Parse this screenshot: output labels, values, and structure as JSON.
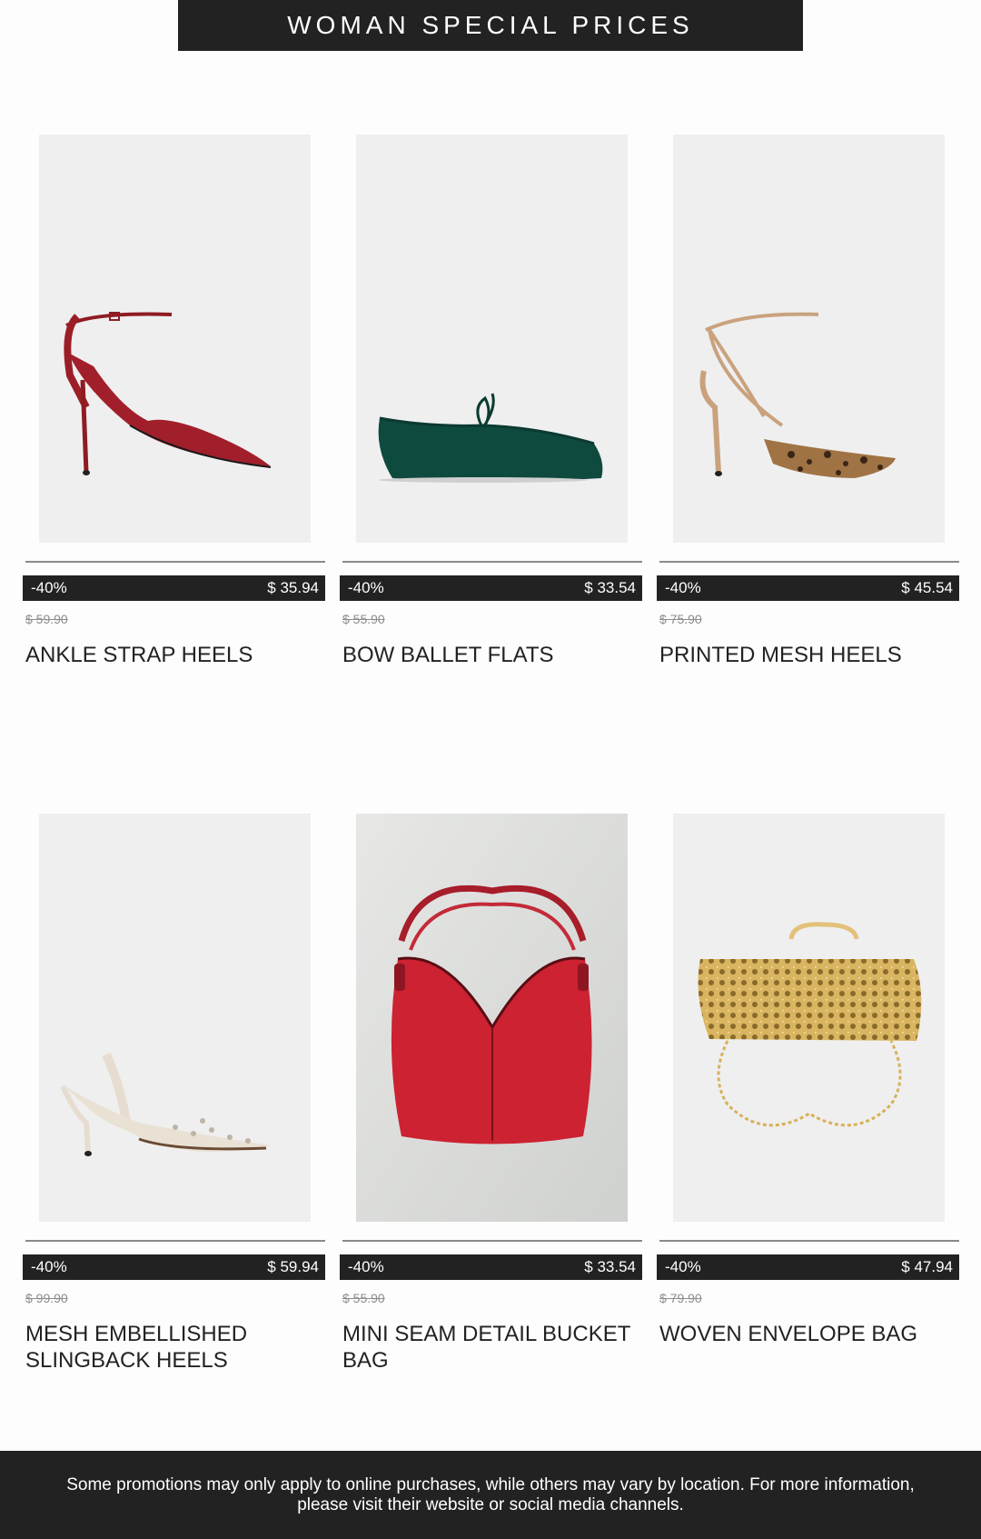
{
  "banner": {
    "title": "WOMAN SPECIAL PRICES"
  },
  "products": [
    {
      "discount": "-40%",
      "price": "$ 35.94",
      "old_price": "$ 59.90",
      "name": "ANKLE STRAP HEELS",
      "image": "red-ankle-strap-heel"
    },
    {
      "discount": "-40%",
      "price": "$ 33.54",
      "old_price": "$ 55.90",
      "name": "BOW BALLET FLATS",
      "image": "green-ballet-flat"
    },
    {
      "discount": "-40%",
      "price": "$ 45.54",
      "old_price": "$ 75.90",
      "name": "PRINTED MESH HEELS",
      "image": "leopard-mesh-heel"
    },
    {
      "discount": "-40%",
      "price": "$ 59.94",
      "old_price": "$ 99.90",
      "name": "MESH EMBELLISHED SLINGBACK HEELS",
      "image": "cream-slingback-heel"
    },
    {
      "discount": "-40%",
      "price": "$ 33.54",
      "old_price": "$ 55.90",
      "name": "MINI SEAM DETAIL BUCKET BAG",
      "image": "red-bucket-bag"
    },
    {
      "discount": "-40%",
      "price": "$ 47.94",
      "old_price": "$ 79.90",
      "name": "WOVEN ENVELOPE BAG",
      "image": "gold-woven-bag"
    }
  ],
  "footer": {
    "text": "Some promotions may only apply to online purchases, while others may vary by location. For more information, please visit their website or social media channels."
  }
}
